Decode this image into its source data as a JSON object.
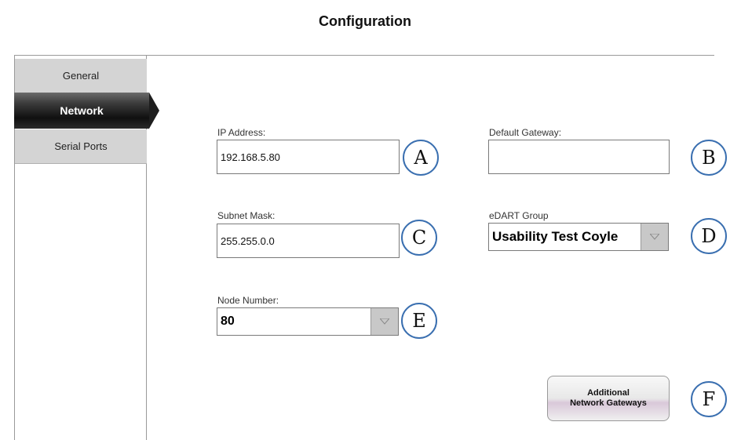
{
  "page": {
    "title": "Configuration"
  },
  "sidebar": {
    "items": [
      {
        "label": "General"
      },
      {
        "label": "Network"
      },
      {
        "label": "Serial Ports"
      }
    ]
  },
  "fields": {
    "ip_address": {
      "label": "IP Address:",
      "value": "192.168.5.80"
    },
    "default_gateway": {
      "label": "Default Gateway:",
      "value": ""
    },
    "subnet_mask": {
      "label": "Subnet Mask:",
      "value": "255.255.0.0"
    },
    "edart_group": {
      "label": "eDART Group",
      "value": "Usability Test Coyle"
    },
    "node_number": {
      "label": "Node Number:",
      "value": "80"
    }
  },
  "buttons": {
    "additional_gateways": {
      "line1": "Additional",
      "line2": "Network Gateways"
    }
  },
  "markers": {
    "a": "A",
    "b": "B",
    "c": "C",
    "d": "D",
    "e": "E",
    "f": "F"
  },
  "colors": {
    "marker_outline": "#3a6fb0",
    "active_tab": "#1e1e1e",
    "inactive_tab": "#d4d4d4"
  }
}
